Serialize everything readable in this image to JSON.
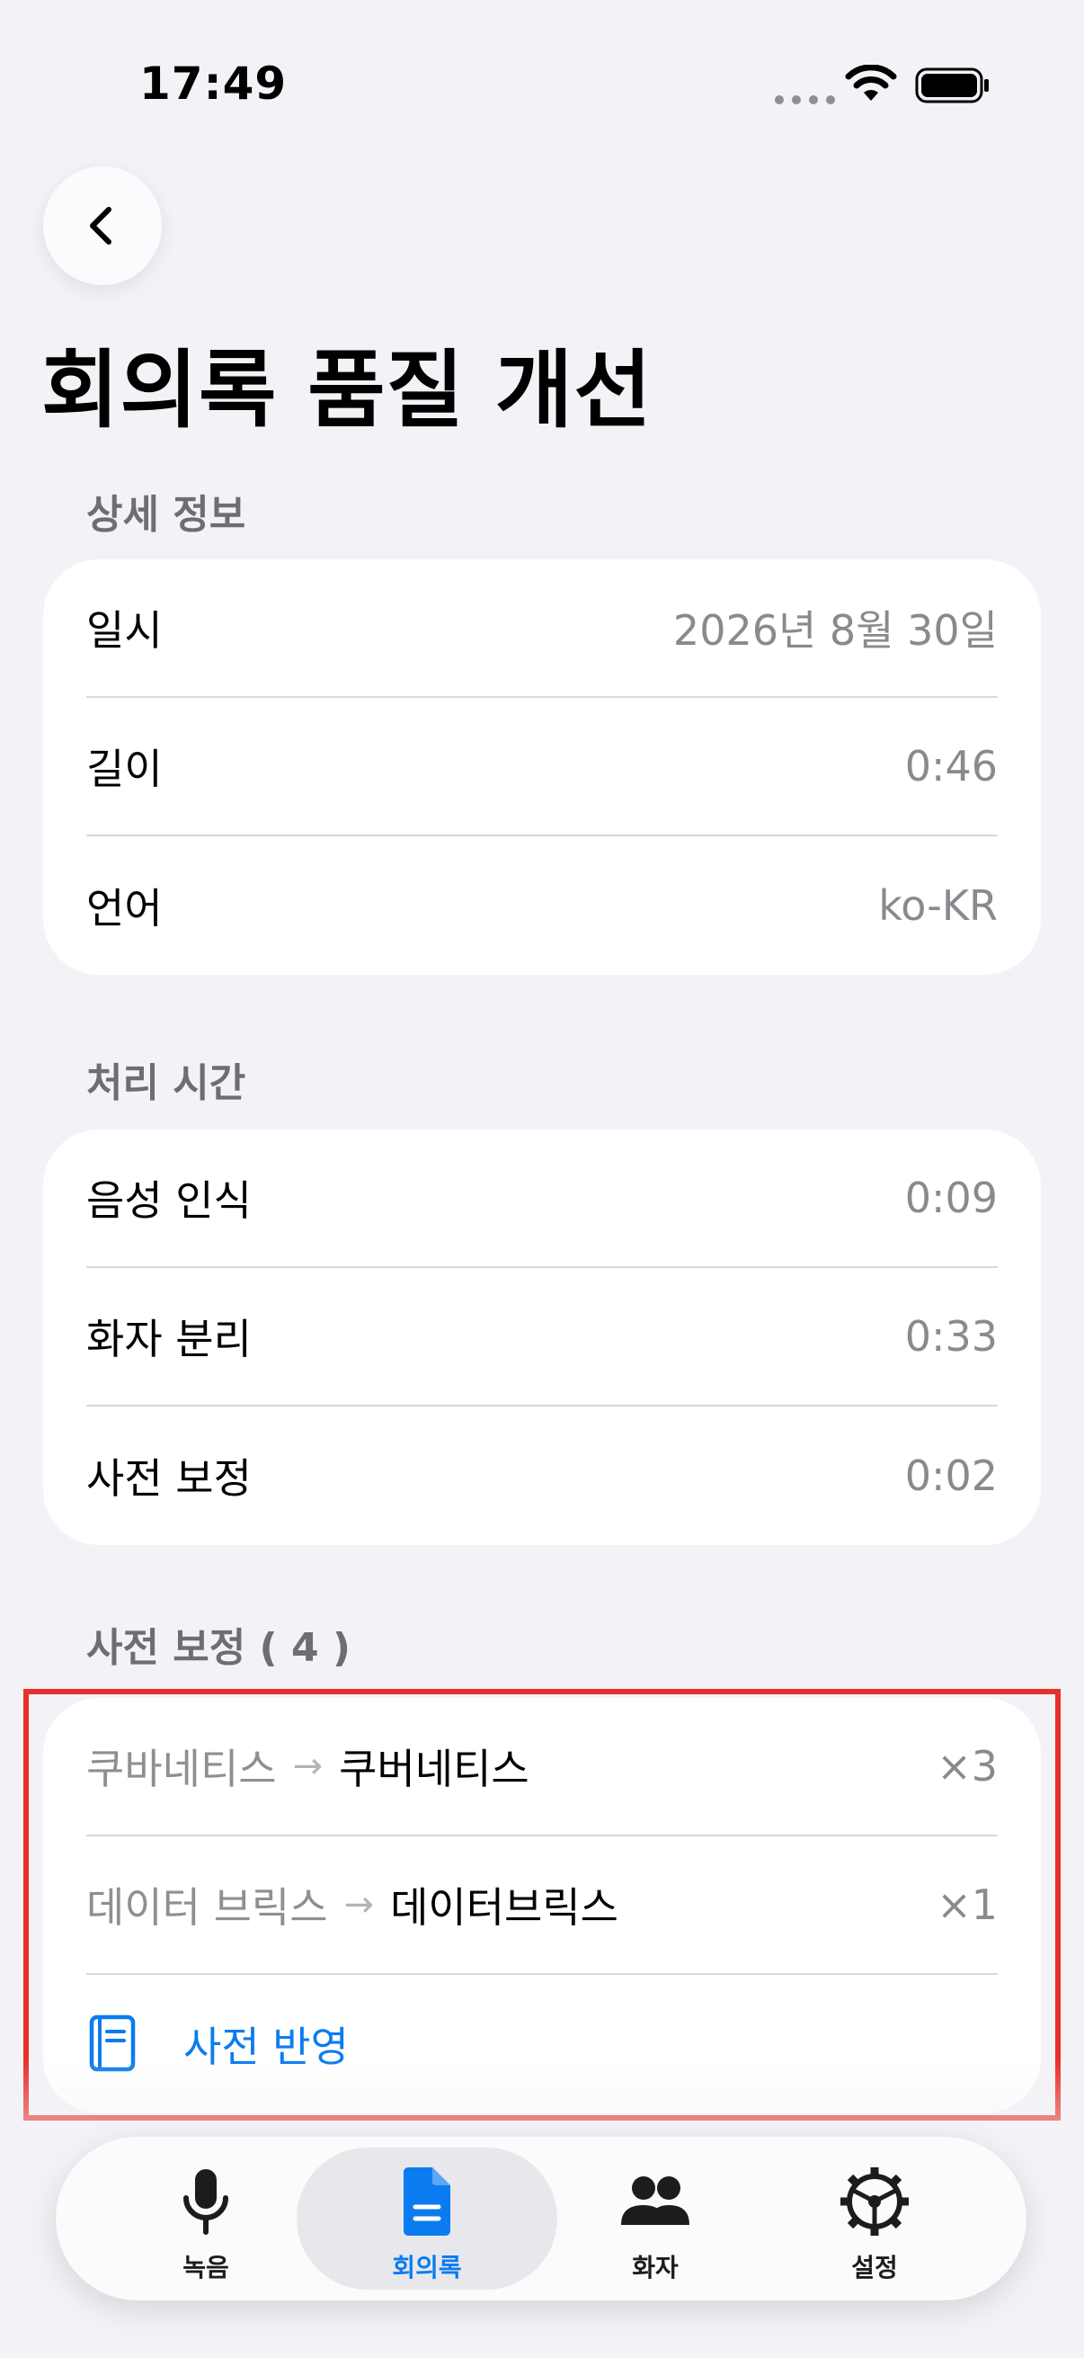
{
  "status_bar": {
    "time": "17:49"
  },
  "header": {
    "title": "회의록 품질 개선"
  },
  "details": {
    "section_title": "상세 정보",
    "rows": [
      {
        "label": "일시",
        "value": "2026년 8월 30일"
      },
      {
        "label": "길이",
        "value": "0:46"
      },
      {
        "label": "언어",
        "value": "ko-KR"
      }
    ]
  },
  "processing": {
    "section_title": "처리 시간",
    "rows": [
      {
        "label": "음성 인식",
        "value": "0:09"
      },
      {
        "label": "화자 분리",
        "value": "0:33"
      },
      {
        "label": "사전 보정",
        "value": "0:02"
      }
    ]
  },
  "corrections": {
    "section_title": "사전 보정 ( 4 )",
    "items": [
      {
        "from": "쿠바네티스",
        "to": "쿠버네티스",
        "count": "×3"
      },
      {
        "from": "데이터 브릭스",
        "to": "데이터브릭스",
        "count": "×1"
      }
    ],
    "apply_label": "사전 반영"
  },
  "tabbar": {
    "tabs": [
      {
        "label": "녹음",
        "icon": "mic-icon",
        "active": false
      },
      {
        "label": "회의록",
        "icon": "document-icon",
        "active": true
      },
      {
        "label": "화자",
        "icon": "people-icon",
        "active": false
      },
      {
        "label": "설정",
        "icon": "gear-icon",
        "active": false
      }
    ]
  },
  "colors": {
    "accent": "#0a7cf0",
    "background": "#f2f2f7",
    "highlight": "#e8302a"
  }
}
